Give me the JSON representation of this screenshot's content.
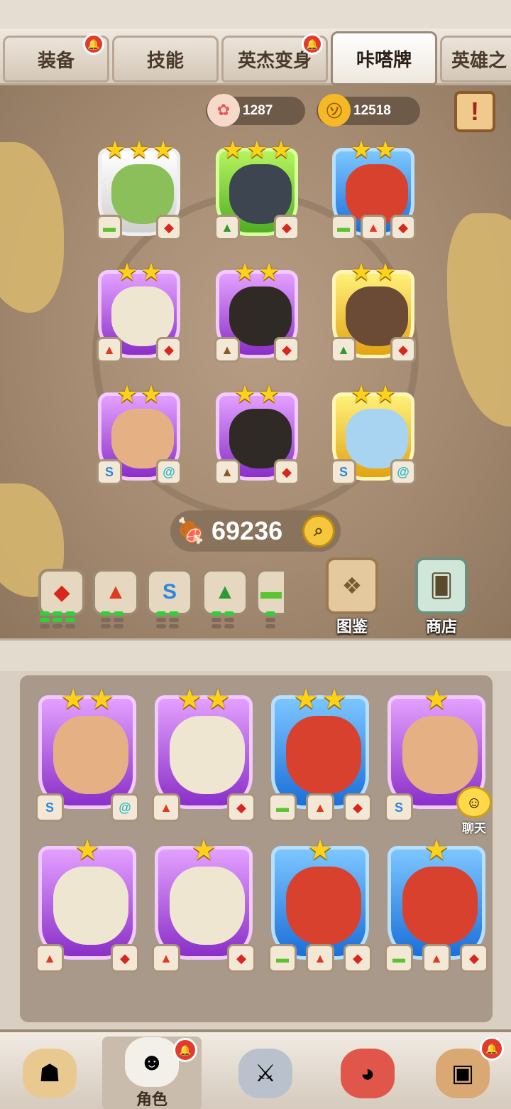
{
  "tabs": [
    {
      "label": "装备",
      "notify": true
    },
    {
      "label": "技能",
      "notify": false
    },
    {
      "label": "英杰变身",
      "notify": true
    },
    {
      "label": "咔嗒牌",
      "notify": false,
      "active": true
    },
    {
      "label": "英雄之",
      "notify": false
    }
  ],
  "currency": {
    "shells": "1287",
    "coins": "12518"
  },
  "meat_total": "69236",
  "side_buttons": {
    "codex": "图鉴",
    "shop": "商店"
  },
  "chat_label": "聊天",
  "nav": {
    "active_label": "角色"
  },
  "colors": {
    "fire": "#d8261c",
    "volcano": "#e03a1f",
    "water": "#2e86e0",
    "forest": "#2f9a34",
    "grass": "#5cc232",
    "mud": "#8a5a2a",
    "wind": "#2bb7c9",
    "star": "#ffd21a"
  }
}
